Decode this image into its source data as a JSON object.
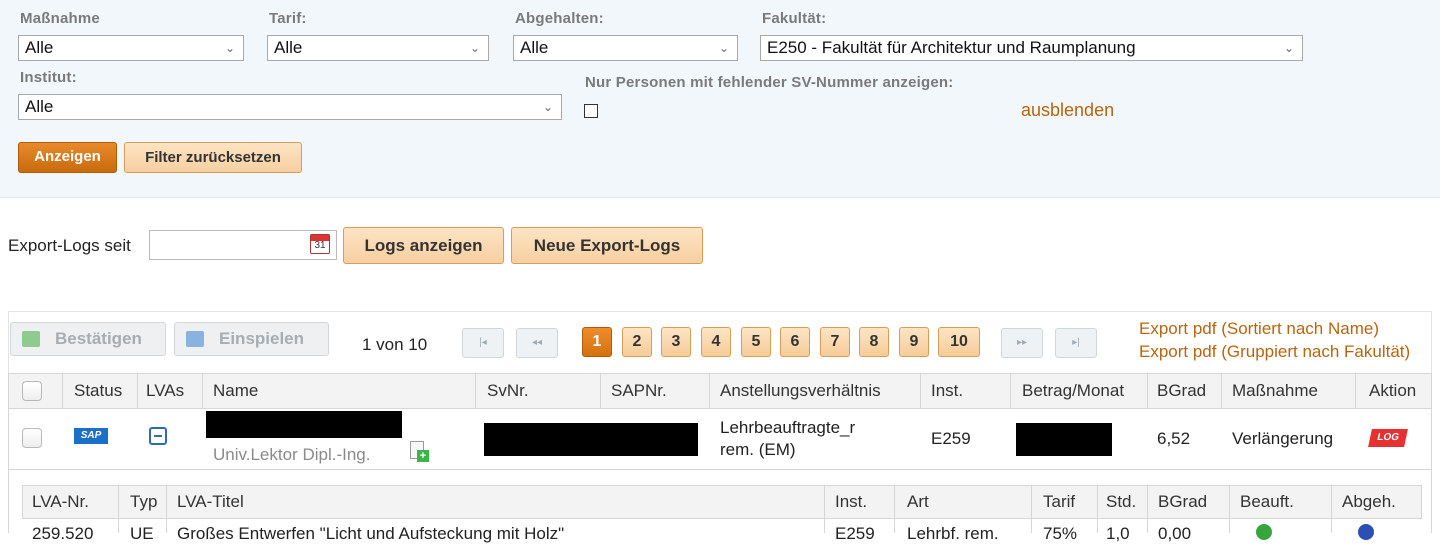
{
  "filters": {
    "massnahme": {
      "label": "Maßnahme",
      "value": "Alle"
    },
    "tarif": {
      "label": "Tarif:",
      "value": "Alle"
    },
    "abgehalten": {
      "label": "Abgehalten:",
      "value": "Alle"
    },
    "fakultaet": {
      "label": "Fakultät:",
      "value": "E250 - Fakultät für Architektur und Raumplanung"
    },
    "institut": {
      "label": "Institut:",
      "value": "Alle"
    },
    "sv_missing": {
      "label": "Nur Personen mit fehlender SV-Nummer anzeigen:",
      "checked": false
    },
    "hide_link": "ausblenden",
    "show_button": "Anzeigen",
    "reset_button": "Filter zurücksetzen"
  },
  "export": {
    "label": "Export-Logs seit",
    "date_value": "",
    "calendar_day": "31",
    "logs_button": "Logs anzeigen",
    "new_logs_button": "Neue Export-Logs"
  },
  "toolbar": {
    "confirm_button": "Bestätigen",
    "import_button": "Einspielen",
    "page_info": "1 von 10",
    "pages": [
      "1",
      "2",
      "3",
      "4",
      "5",
      "6",
      "7",
      "8",
      "9",
      "10"
    ],
    "current_page": "1",
    "nav_first": "|◂",
    "nav_prev": "◂◂",
    "nav_next": "▸▸",
    "nav_last": "▸|",
    "export_pdf_name": "Export pdf (Sortiert nach Name)",
    "export_pdf_faculty": "Export pdf (Gruppiert nach Fakultät)"
  },
  "table": {
    "headers": [
      "Status",
      "LVAs",
      "Name",
      "SvNr.",
      "SAPNr.",
      "Anstellungsverhältnis",
      "Inst.",
      "Betrag/Monat",
      "BGrad",
      "Maßnahme",
      "Aktion"
    ],
    "row": {
      "status_badge": "SAP",
      "name_title": "Univ.Lektor Dipl.-Ing.",
      "anstellung_line1": "Lehrbeauftragte_r",
      "anstellung_line2": "rem. (EM)",
      "inst": "E259",
      "bgrad": "6,52",
      "massnahme": "Verlängerung",
      "aktion_badge": "LOG"
    }
  },
  "subtable": {
    "headers": [
      "LVA-Nr.",
      "Typ",
      "LVA-Titel",
      "Inst.",
      "Art",
      "Tarif",
      "Std.",
      "BGrad",
      "Beauft.",
      "Abgeh."
    ],
    "row": {
      "lva_nr": "259.520",
      "typ": "UE",
      "titel": "Großes Entwerfen \"Licht und Aufsteckung mit Holz\"",
      "inst": "E259",
      "art": "Lehrbf. rem.",
      "tarif": "75%",
      "std": "1,0",
      "bgrad": "0,00"
    }
  },
  "colors": {
    "accent": "#d5700f",
    "link": "#b8650f",
    "panel_bg": "#f1f7fa"
  }
}
